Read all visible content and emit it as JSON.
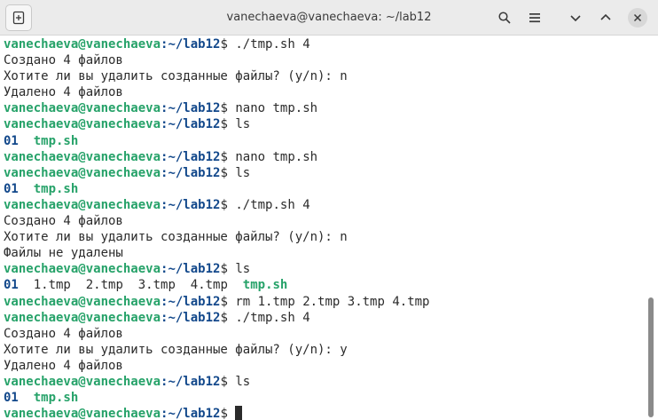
{
  "window": {
    "title": "vanechaeva@vanechaeva: ~/lab12"
  },
  "icons": {
    "new_tab": "new-tab-icon",
    "search": "search-icon",
    "menu": "hamburger-menu-icon",
    "expand": "chevron-down-icon",
    "collapse": "chevron-up-icon",
    "close": "close-icon"
  },
  "colors": {
    "prompt_user": "#26a269",
    "prompt_path": "#12488b",
    "executable": "#26a269",
    "directory": "#12488b",
    "text": "#2b2b2b"
  },
  "terminal": {
    "lines": [
      {
        "type": "prompt",
        "user": "vanechaeva@vanechaeva",
        "sep": ":",
        "path": "~/lab12",
        "sym": "$",
        "cmd": " ./tmp.sh 4"
      },
      {
        "type": "text",
        "text": "Создано 4 файлов"
      },
      {
        "type": "text",
        "text": "Хотите ли вы удалить созданные файлы? (y/n): n"
      },
      {
        "type": "text",
        "text": "Удалено 4 файлов"
      },
      {
        "type": "prompt",
        "user": "vanechaeva@vanechaeva",
        "sep": ":",
        "path": "~/lab12",
        "sym": "$",
        "cmd": " nano tmp.sh"
      },
      {
        "type": "prompt",
        "user": "vanechaeva@vanechaeva",
        "sep": ":",
        "path": "~/lab12",
        "sym": "$",
        "cmd": " ls"
      },
      {
        "type": "ls",
        "items": [
          {
            "name": "01",
            "kind": "dir"
          },
          {
            "name": "tmp.sh",
            "kind": "exe"
          }
        ]
      },
      {
        "type": "prompt",
        "user": "vanechaeva@vanechaeva",
        "sep": ":",
        "path": "~/lab12",
        "sym": "$",
        "cmd": " nano tmp.sh"
      },
      {
        "type": "prompt",
        "user": "vanechaeva@vanechaeva",
        "sep": ":",
        "path": "~/lab12",
        "sym": "$",
        "cmd": " ls"
      },
      {
        "type": "ls",
        "items": [
          {
            "name": "01",
            "kind": "dir"
          },
          {
            "name": "tmp.sh",
            "kind": "exe"
          }
        ]
      },
      {
        "type": "prompt",
        "user": "vanechaeva@vanechaeva",
        "sep": ":",
        "path": "~/lab12",
        "sym": "$",
        "cmd": " ./tmp.sh 4"
      },
      {
        "type": "text",
        "text": "Создано 4 файлов"
      },
      {
        "type": "text",
        "text": "Хотите ли вы удалить созданные файлы? (y/n): n"
      },
      {
        "type": "text",
        "text": "Файлы не удалены"
      },
      {
        "type": "prompt",
        "user": "vanechaeva@vanechaeva",
        "sep": ":",
        "path": "~/lab12",
        "sym": "$",
        "cmd": " ls"
      },
      {
        "type": "ls",
        "items": [
          {
            "name": "01",
            "kind": "dir"
          },
          {
            "name": "1.tmp",
            "kind": "file"
          },
          {
            "name": "2.tmp",
            "kind": "file"
          },
          {
            "name": "3.tmp",
            "kind": "file"
          },
          {
            "name": "4.tmp",
            "kind": "file"
          },
          {
            "name": "tmp.sh",
            "kind": "exe"
          }
        ]
      },
      {
        "type": "prompt",
        "user": "vanechaeva@vanechaeva",
        "sep": ":",
        "path": "~/lab12",
        "sym": "$",
        "cmd": " rm 1.tmp 2.tmp 3.tmp 4.tmp"
      },
      {
        "type": "prompt",
        "user": "vanechaeva@vanechaeva",
        "sep": ":",
        "path": "~/lab12",
        "sym": "$",
        "cmd": " ./tmp.sh 4"
      },
      {
        "type": "text",
        "text": "Создано 4 файлов"
      },
      {
        "type": "text",
        "text": "Хотите ли вы удалить созданные файлы? (y/n): y"
      },
      {
        "type": "text",
        "text": "Удалено 4 файлов"
      },
      {
        "type": "prompt",
        "user": "vanechaeva@vanechaeva",
        "sep": ":",
        "path": "~/lab12",
        "sym": "$",
        "cmd": " ls"
      },
      {
        "type": "ls",
        "items": [
          {
            "name": "01",
            "kind": "dir"
          },
          {
            "name": "tmp.sh",
            "kind": "exe"
          }
        ]
      },
      {
        "type": "prompt",
        "user": "vanechaeva@vanechaeva",
        "sep": ":",
        "path": "~/lab12",
        "sym": "$",
        "cmd": " ",
        "cursor": true
      }
    ]
  }
}
